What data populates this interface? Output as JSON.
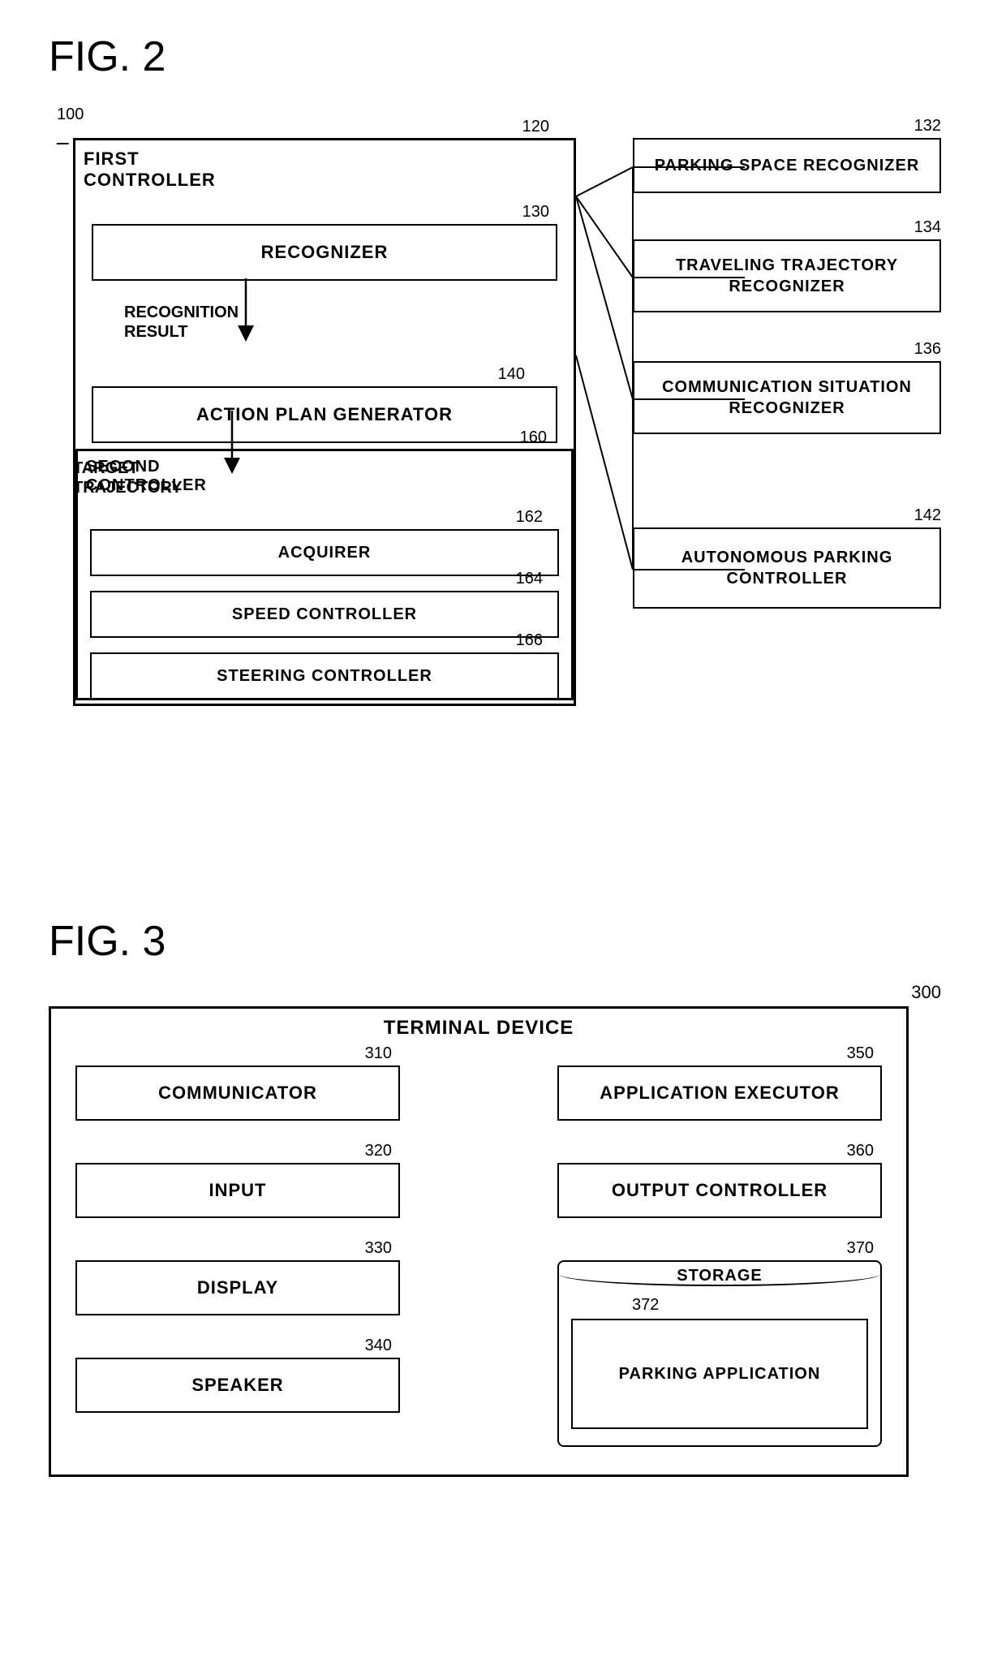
{
  "fig2": {
    "title": "FIG. 2",
    "ref100": "100",
    "ref120": "120",
    "ref130": "130",
    "ref140": "140",
    "ref160": "160",
    "ref162": "162",
    "ref164": "164",
    "ref166": "166",
    "ref132": "132",
    "ref134": "134",
    "ref136": "136",
    "ref142": "142",
    "label_first_controller": "FIRST\nCONTROLLER",
    "label_second_controller": "SECOND\nCONTROLLER",
    "label_recognizer": "RECOGNIZER",
    "label_action_plan": "ACTION PLAN GENERATOR",
    "label_acquirer": "ACQUIRER",
    "label_speed": "SPEED CONTROLLER",
    "label_steering": "STEERING CONTROLLER",
    "label_parking_space": "PARKING SPACE RECOGNIZER",
    "label_traveling": "TRAVELING TRAJECTORY\nRECOGNIZER",
    "label_communication": "COMMUNICATION SITUATION\nRECOGNIZER",
    "label_autonomous": "AUTONOMOUS PARKING\nCONTROLLER",
    "label_recognition_result": "RECOGNITION\nRESULT",
    "label_target_trajectory": "TARGET\nTRAJECTORY"
  },
  "fig3": {
    "title": "FIG. 3",
    "ref300": "300",
    "ref310": "310",
    "ref320": "320",
    "ref330": "330",
    "ref340": "340",
    "ref350": "350",
    "ref360": "360",
    "ref370": "370",
    "ref372": "372",
    "label_terminal": "TERMINAL DEVICE",
    "label_communicator": "COMMUNICATOR",
    "label_input": "INPUT",
    "label_display": "DISPLAY",
    "label_speaker": "SPEAKER",
    "label_app_executor": "APPLICATION EXECUTOR",
    "label_output_controller": "OUTPUT CONTROLLER",
    "label_storage": "STORAGE",
    "label_parking_app": "PARKING APPLICATION"
  }
}
